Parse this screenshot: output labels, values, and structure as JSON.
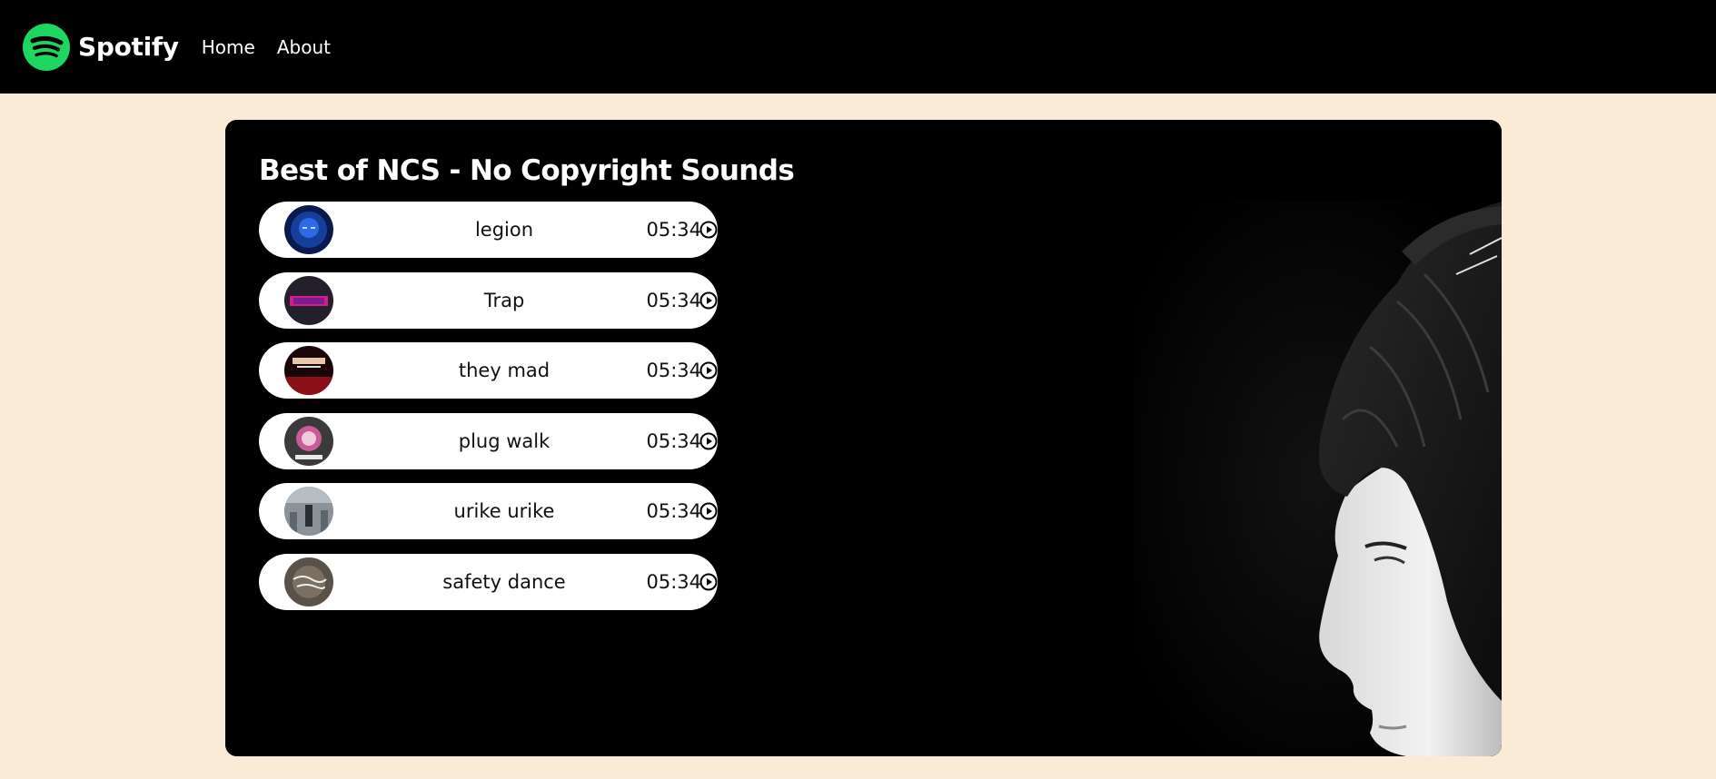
{
  "nav": {
    "brand": "Spotify",
    "links": [
      "Home",
      "About"
    ],
    "brand_color": "#1ed760"
  },
  "playlist": {
    "title": "Best of NCS - No Copyright Sounds",
    "songs": [
      {
        "name": "legion",
        "duration": "05:34"
      },
      {
        "name": "Trap",
        "duration": "05:34"
      },
      {
        "name": "they mad",
        "duration": "05:34"
      },
      {
        "name": "plug walk",
        "duration": "05:34"
      },
      {
        "name": "urike urike",
        "duration": "05:34"
      },
      {
        "name": "safety dance",
        "duration": "05:34"
      }
    ]
  },
  "colors": {
    "page_background": "#faebd7",
    "navbar": "#000000",
    "card": "#000000",
    "song_row": "#ffffff"
  },
  "icons": {
    "logo": "spotify-logo-icon",
    "play": "play-circle-icon"
  }
}
